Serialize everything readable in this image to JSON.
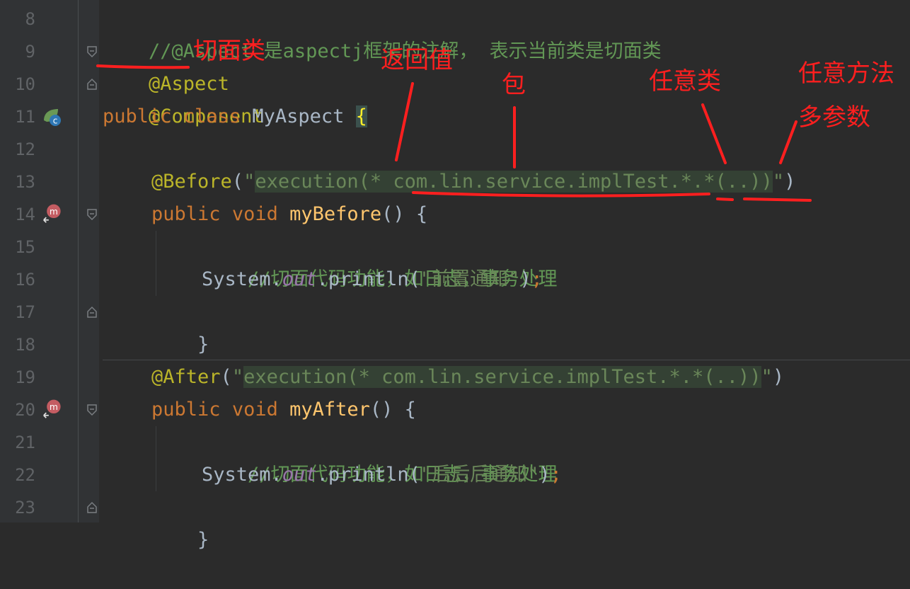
{
  "lines": [
    {
      "num": "8"
    },
    {
      "num": "9"
    },
    {
      "num": "10"
    },
    {
      "num": "11"
    },
    {
      "num": "12"
    },
    {
      "num": "13"
    },
    {
      "num": "14"
    },
    {
      "num": "15"
    },
    {
      "num": "16"
    },
    {
      "num": "17"
    },
    {
      "num": "18"
    },
    {
      "num": "19"
    },
    {
      "num": "20"
    },
    {
      "num": "21"
    },
    {
      "num": "22"
    },
    {
      "num": "23"
    }
  ],
  "code": {
    "l8_comment": "//@Aspect 是aspectj框架的注解， 表示当前类是切面类",
    "l9_annotation": "@Aspect",
    "l10_annotation": "@Component",
    "l11_public": "public",
    "l11_class": "class",
    "l11_name": "MyAspect",
    "l11_brace": "{",
    "l13_annotation": "@Before",
    "l13_open": "(",
    "l13_quote_open": "\"",
    "l13_expr": "execution(* com.lin.service.implTest.*.*(..))",
    "l13_quote_close": "\"",
    "l13_close": ")",
    "l14_public": "public",
    "l14_void": "void",
    "l14_name": "myBefore",
    "l14_rest": "() {",
    "l15_comment": "//切面代码功能，如日志，事务处理",
    "l16_system": "System.",
    "l16_out": "out",
    "l16_println": ".println(",
    "l16_str": "\"前置通知\"",
    "l16_close": ")",
    "l16_semi": ";",
    "l17_brace": "}",
    "l19_annotation": "@After",
    "l19_open": "(",
    "l19_quote_open": "\"",
    "l19_expr": "execution(* com.lin.service.implTest.*.*(..))",
    "l19_quote_close": "\"",
    "l19_close": ")",
    "l20_public": "public",
    "l20_void": "void",
    "l20_name": "myAfter",
    "l20_rest": "() {",
    "l21_comment": "//切面代码功能，如日志，事务处理",
    "l22_system": "System.",
    "l22_out": "out",
    "l22_println": ".println(",
    "l22_str": "\"后后后通知\"",
    "l22_close": ")",
    "l22_semi": ";",
    "l23_brace": "}"
  },
  "annotations": {
    "aspect_class": "切面类",
    "return_value": "返回值",
    "package": "包",
    "any_class": "任意类",
    "any_method": "任意方法",
    "multi_params": "多参数"
  },
  "gutter_icons": {
    "line11": "class-bean-icon",
    "line14": "advice-method-icon",
    "line20": "advice-method-icon"
  },
  "colors": {
    "annotation_ink": "#ff1f1f",
    "editor_bg": "#2b2b2b",
    "keyword": "#cc7832",
    "comment": "#629755"
  }
}
